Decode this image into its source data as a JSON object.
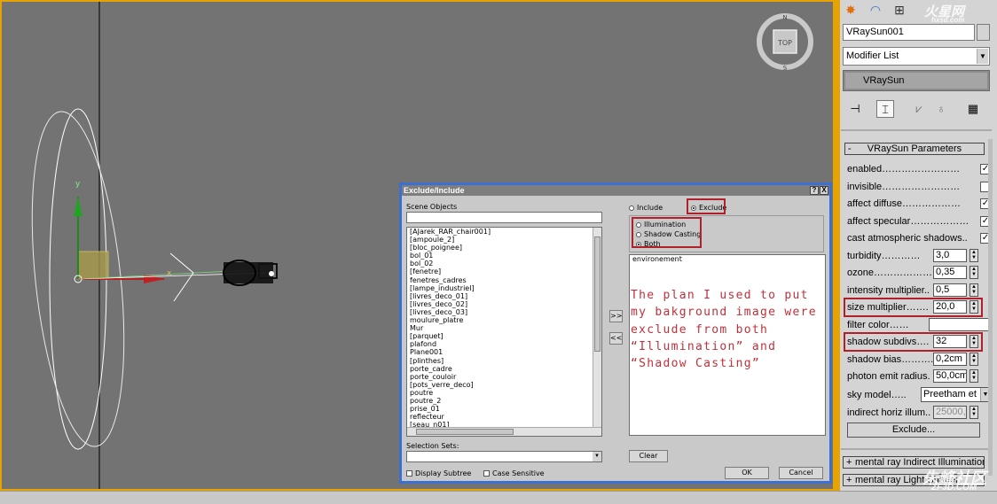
{
  "viewport": {
    "axis_y_label": "y",
    "axis_x_label": "x",
    "viewcube_top": "TOP",
    "viewcube_n": "N",
    "viewcube_s": "S"
  },
  "dialog": {
    "title": "Exclude/Include",
    "help_btn": "?",
    "close_btn": "X",
    "scene_objects_label": "Scene Objects",
    "scene_objects": [
      "[AJarek_RAR_chair001]",
      "[ampoule_2]",
      "[bloc_poignee]",
      "bol_01",
      "bol_02",
      "[fenetre]",
      "fenetres_cadres",
      "[lampe_industriel]",
      "[livres_deco_01]",
      "[livres_deco_02]",
      "[livres_deco_03]",
      "moulure_platre",
      "Mur",
      "[parquet]",
      "plafond",
      "Plane001",
      "[plinthes]",
      "porte_cadre",
      "porte_couloir",
      "[pots_verre_deco]",
      "poutre",
      "poutre_2",
      "prise_01",
      "reflecteur",
      "[seau_n01]"
    ],
    "selection_sets_label": "Selection Sets:",
    "display_subtree": "Display Subtree",
    "case_sensitive": "Case Sensitive",
    "include_label": "Include",
    "exclude_label": "Exclude",
    "illumination": "Illumination",
    "shadow_casting": "Shadow Casting",
    "both": "Both",
    "excluded_items": [
      "environement"
    ],
    "move_right": ">>",
    "move_left": "<<",
    "clear_btn": "Clear",
    "ok_btn": "OK",
    "cancel_btn": "Cancel",
    "annotation": "The plan I used to put my bakground image were exclude from both “Illumination” and “Shadow Casting”"
  },
  "panel": {
    "object_name": "VRaySun001",
    "modifier_list": "Modifier List",
    "stack_item": "VRaySun",
    "rollout_title": "VRaySun Parameters",
    "rollout_toggle": "-",
    "params": [
      {
        "label": "enabled……………………",
        "checked": "✓"
      },
      {
        "label": "invisible……………………",
        "checked": ""
      },
      {
        "label": "affect diffuse………………",
        "checked": "✓"
      },
      {
        "label": "affect specular………………",
        "checked": "✓"
      },
      {
        "label": "cast atmospheric shadows..",
        "checked": "✓"
      }
    ],
    "turbidity_label": "turbidity…………",
    "turbidity": "3,0",
    "ozone_label": "ozone………………",
    "ozone": "0,35",
    "intensity_label": "intensity multiplier..",
    "intensity": "0,5",
    "size_label": "size multiplier…….",
    "size": "20,0",
    "filter_label": "filter color……",
    "shadow_subdivs_label": "shadow subdivs….",
    "shadow_subdivs": "32",
    "shadow_bias_label": "shadow bias……….",
    "shadow_bias": "0,2cm",
    "photon_label": "photon emit radius.",
    "photon": "50,0cm",
    "sky_model_label": "sky model…..",
    "sky_model": "Preetham et",
    "indirect_label": "indirect horiz illum..",
    "indirect": "25000,",
    "exclude_btn": "Exclude...",
    "rollout2": "mental ray Indirect Illumination",
    "rollout3": "mental ray Light Shader",
    "rollout_plus": "+"
  },
  "watermarks": {
    "top_right": "火星网",
    "top_right_sub": "hxsd.com",
    "bottom_right": "朱峰社区",
    "bottom_right_sub": "ZF3D.COM"
  }
}
